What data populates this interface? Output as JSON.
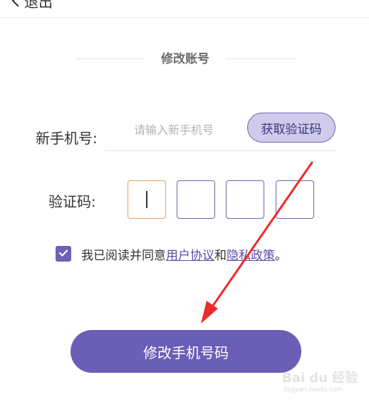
{
  "header": {
    "back_label": "退出"
  },
  "section": {
    "title": "修改账号"
  },
  "phone": {
    "label": "新手机号:",
    "placeholder": "请输入新手机号",
    "value": "",
    "get_code_label": "获取验证码"
  },
  "verify": {
    "label": "验证码:",
    "digits": [
      "",
      "",
      "",
      ""
    ]
  },
  "agreement": {
    "checked": true,
    "prefix": "我已阅读并同意",
    "user_agreement": "用户协议",
    "conjunction": "和",
    "privacy_policy": "隐私政策",
    "suffix": "。"
  },
  "submit": {
    "label": "修改手机号码"
  },
  "watermark": {
    "brand": "Bai du 经验",
    "url": "jingyan.baidu.com"
  },
  "colors": {
    "accent": "#6a5eb6",
    "code_button_bg": "#cfcbea",
    "active_box_border": "#e6a060",
    "annotation_arrow": "#ee2b2b"
  },
  "icons": {
    "back": "chevron-left-icon",
    "checkbox": "checkmark-icon",
    "annotation": "red-arrow-icon",
    "watermark": "paw-icon"
  }
}
